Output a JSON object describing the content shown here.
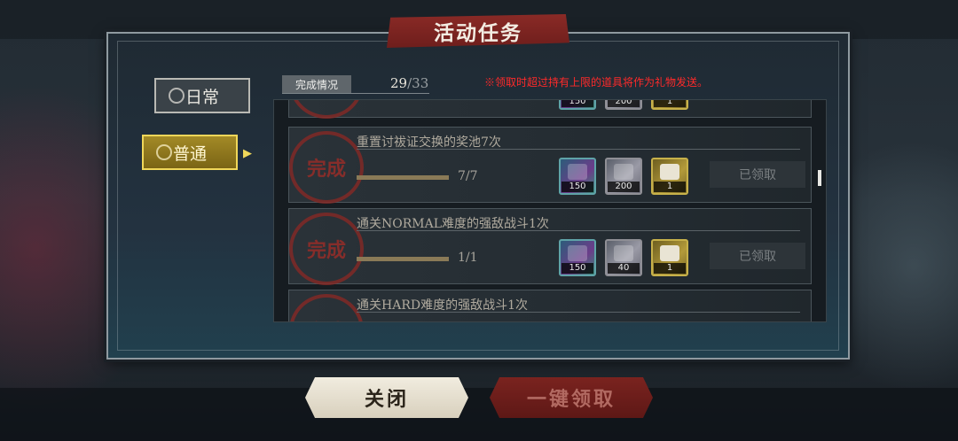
{
  "title": "活动任务",
  "tabs": [
    {
      "label": "日常",
      "active": false
    },
    {
      "label": "普通",
      "active": true
    }
  ],
  "progress": {
    "label": "完成情况",
    "completed": "29",
    "total": "/33"
  },
  "notice": "※领取时超过持有上限的道具将作为礼物发送。",
  "stamp_text": "完成",
  "top_partial_row": {
    "rewards": [
      {
        "icon": "crystal-icon",
        "qty": "150"
      },
      {
        "icon": "cloth-icon",
        "qty": "200"
      },
      {
        "icon": "ticket-icon",
        "qty": "1"
      }
    ]
  },
  "tasks": [
    {
      "name": "重置讨祓证交换的奖池7次",
      "progress": "7/7",
      "claim_label": "已领取",
      "rewards": [
        {
          "icon": "crystal-icon",
          "qty": "150"
        },
        {
          "icon": "cloth-icon",
          "qty": "200"
        },
        {
          "icon": "ticket-icon",
          "qty": "1"
        }
      ]
    },
    {
      "name": "通关NORMAL难度的强敌战斗1次",
      "progress": "1/1",
      "claim_label": "已领取",
      "rewards": [
        {
          "icon": "crystal-icon",
          "qty": "150"
        },
        {
          "icon": "cloth-icon",
          "qty": "40"
        },
        {
          "icon": "ticket-icon",
          "qty": "1"
        }
      ]
    },
    {
      "name": "通关HARD难度的强敌战斗1次",
      "progress": "",
      "claim_label": "",
      "rewards": []
    }
  ],
  "buttons": {
    "close": "关闭",
    "claim_all": "一键领取"
  },
  "colors": {
    "notice": "#ff2a2a",
    "title_banner": "#8a2a26",
    "active_tab": "#a38a26",
    "stamp": "#962d28"
  }
}
